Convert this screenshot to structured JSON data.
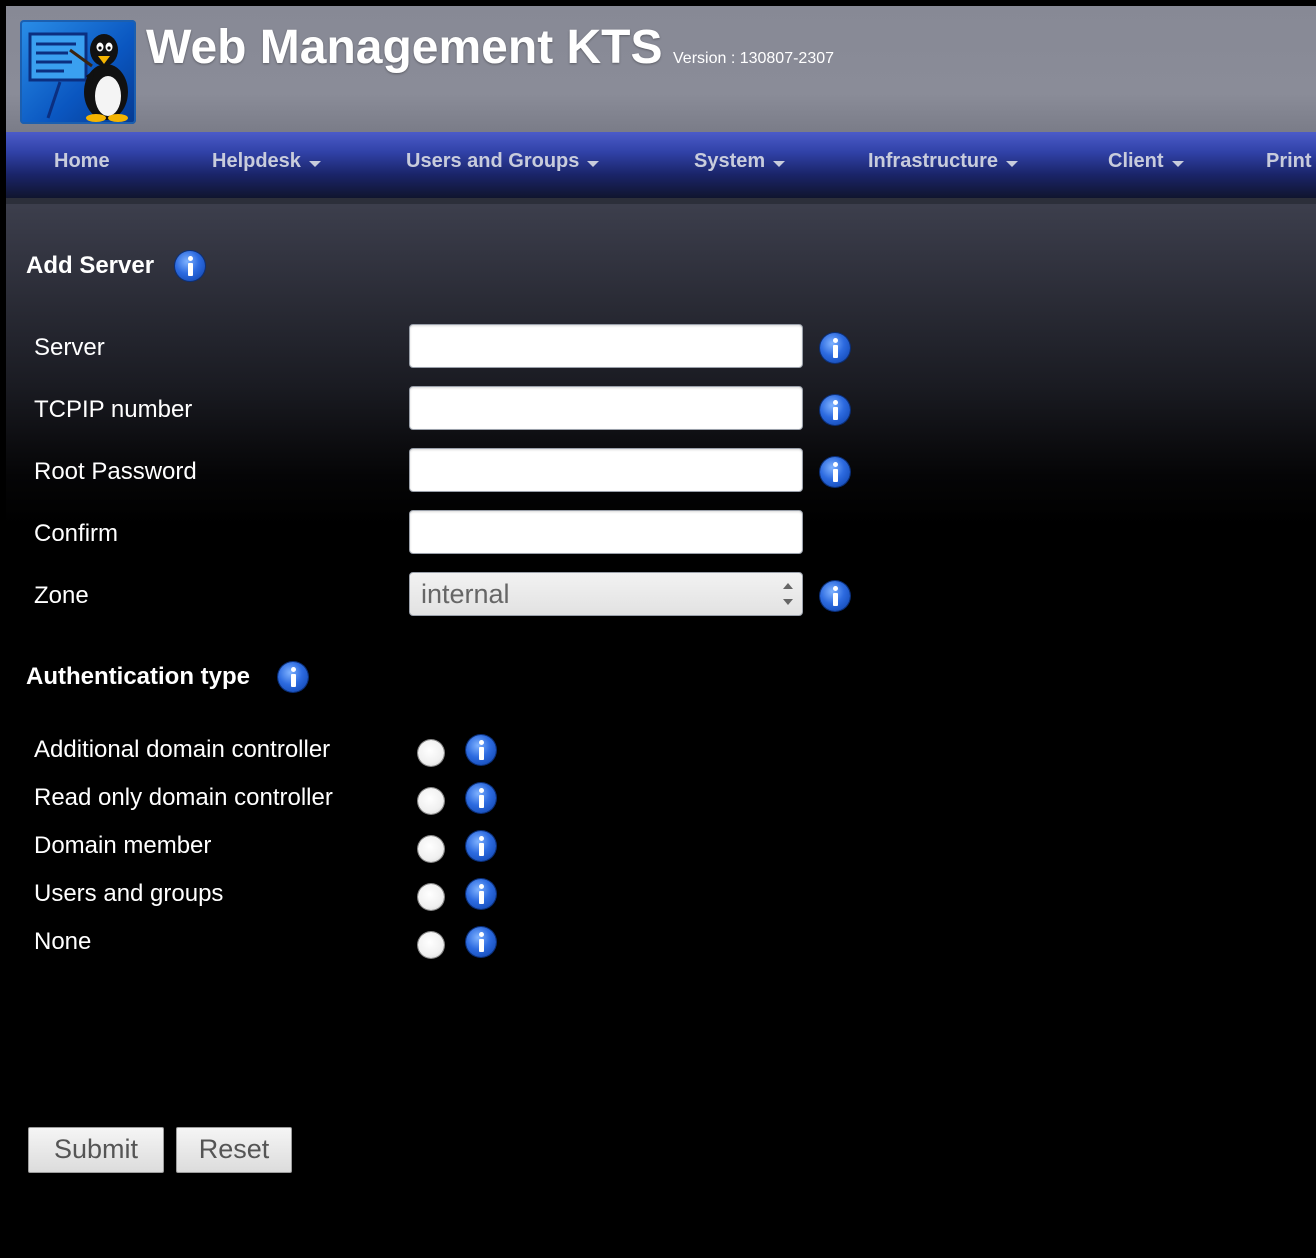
{
  "header": {
    "title": "Web Management KTS",
    "version": "Version : 130807-2307",
    "logo": "tux-teacher-logo-icon"
  },
  "nav": {
    "items": [
      {
        "label": "Home",
        "has_dropdown": false
      },
      {
        "label": "Helpdesk",
        "has_dropdown": true
      },
      {
        "label": "Users and Groups",
        "has_dropdown": true
      },
      {
        "label": "System",
        "has_dropdown": true
      },
      {
        "label": "Infrastructure",
        "has_dropdown": true
      },
      {
        "label": "Client",
        "has_dropdown": true
      },
      {
        "label": "Print",
        "has_dropdown": false
      }
    ]
  },
  "form": {
    "title": "Add Server",
    "fields": [
      {
        "label": "Server",
        "value": "",
        "type": "text"
      },
      {
        "label": "TCPIP number",
        "value": "",
        "type": "text"
      },
      {
        "label": "Root Password",
        "value": "",
        "type": "password"
      },
      {
        "label": "Confirm",
        "value": "",
        "type": "password"
      }
    ],
    "zone": {
      "label": "Zone",
      "selected": "internal"
    },
    "auth": {
      "title": "Authentication type",
      "options": [
        {
          "label": "Additional domain controller",
          "checked": false
        },
        {
          "label": "Read only domain controller",
          "checked": false
        },
        {
          "label": "Domain member",
          "checked": false
        },
        {
          "label": "Users and groups",
          "checked": false
        },
        {
          "label": "None",
          "checked": false
        }
      ]
    },
    "buttons": {
      "submit": "Submit",
      "reset": "Reset"
    }
  },
  "colors": {
    "nav_text": "#c8ccdc",
    "info_icon": "#2d6be0",
    "logo_blue": "#0a56c0"
  }
}
